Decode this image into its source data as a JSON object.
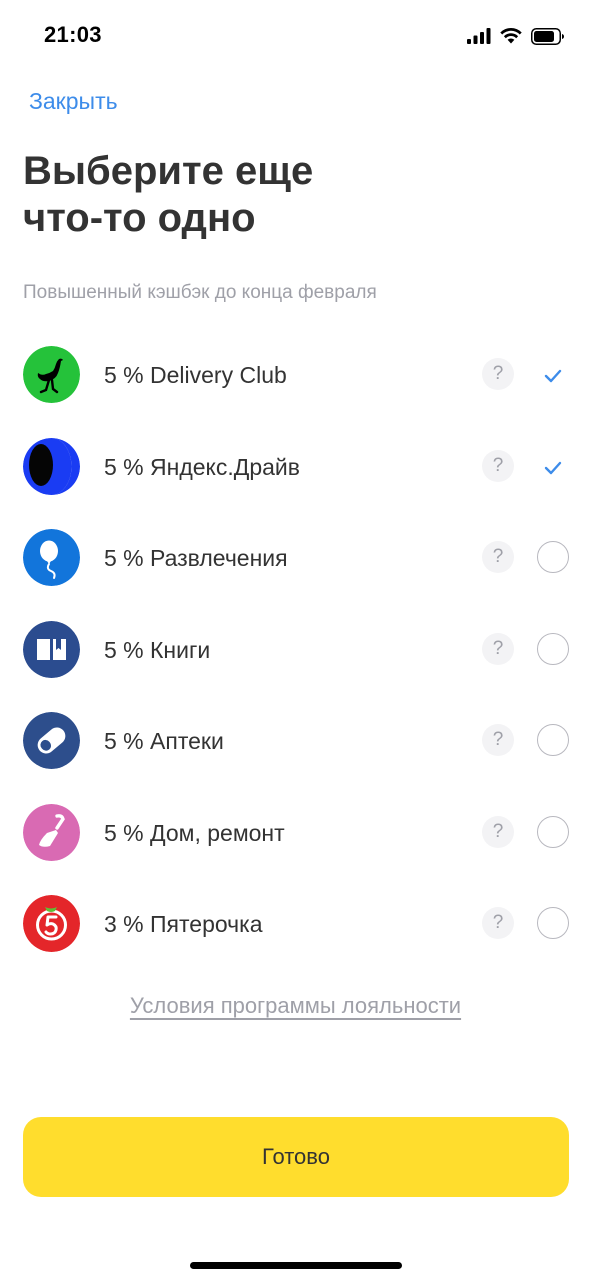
{
  "status_bar": {
    "time": "21:03",
    "icons": [
      "cellular-signal-icon",
      "wifi-icon",
      "battery-icon"
    ]
  },
  "header": {
    "close_label": "Закрыть",
    "title_line1": "Выберите еще",
    "title_line2": "что-то одно",
    "subtitle": "Повышенный кэшбэк до конца февраля"
  },
  "items": [
    {
      "label": "5 % Delivery Club",
      "icon": "ostrich-icon",
      "icon_color": "#25c23a",
      "selected": true
    },
    {
      "label": "5 % Яндекс.Драйв",
      "icon": "yandex-drive-icon",
      "icon_color": "#1a3cf3",
      "selected": true
    },
    {
      "label": "5 % Развлечения",
      "icon": "balloon-icon",
      "icon_color": "#1275db",
      "selected": false
    },
    {
      "label": "5 % Книги",
      "icon": "book-icon",
      "icon_color": "#2b4c8f",
      "selected": false
    },
    {
      "label": "5 % Аптеки",
      "icon": "pill-icon",
      "icon_color": "#2d4e8c",
      "selected": false
    },
    {
      "label": "5 % Дом, ремонт",
      "icon": "trowel-icon",
      "icon_color": "#d96ab3",
      "selected": false
    },
    {
      "label": "3 % Пятерочка",
      "icon": "pyaterochka-logo-icon",
      "icon_color": "#e4262a",
      "selected": false
    }
  ],
  "help_label": "?",
  "colors": {
    "accent_link": "#3d8cea",
    "primary_button": "#ffdd2d",
    "check": "#3d8cea"
  },
  "footer": {
    "loyalty_link": "Условия программы лояльности",
    "done_label": "Готово"
  }
}
